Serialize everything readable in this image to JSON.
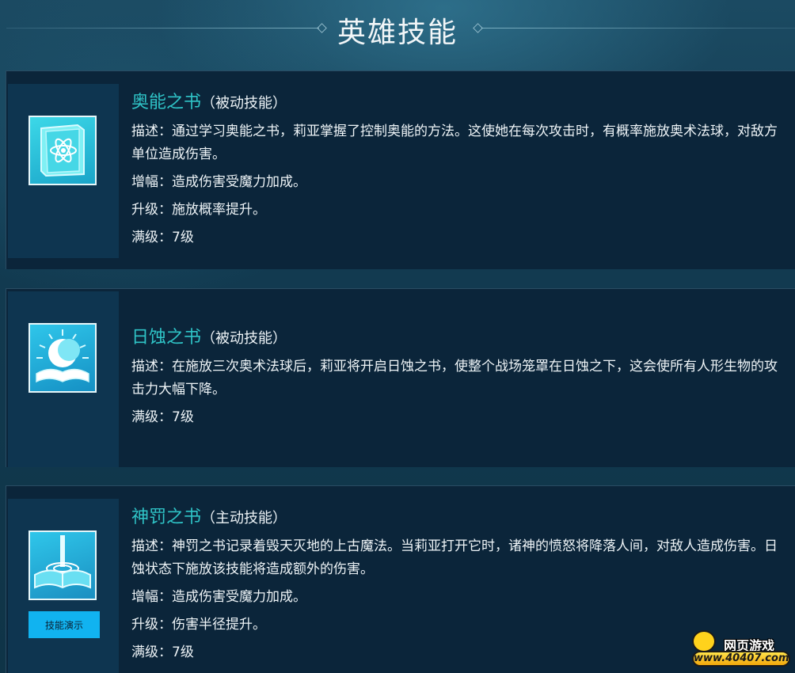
{
  "page": {
    "title": "英雄技能"
  },
  "skills": [
    {
      "name": "奥能之书",
      "type": "（被动技能）",
      "lines": [
        "描述：通过学习奥能之书，莉亚掌握了控制奥能的方法。这使她在每次攻击时，有概率施放奥术法球，对敌方单位造成伤害。",
        "增幅：造成伤害受魔力加成。",
        "升级：施放概率提升。",
        "满级：7级"
      ],
      "icon": "arcane-book-icon"
    },
    {
      "name": "日蚀之书",
      "type": "（被动技能）",
      "lines": [
        "描述：在施放三次奥术法球后，莉亚将开启日蚀之书，使整个战场笼罩在日蚀之下，这会使所有人形生物的攻击力大幅下降。",
        "满级：7级"
      ],
      "icon": "eclipse-book-icon"
    },
    {
      "name": "神罚之书",
      "type": "（主动技能）",
      "lines": [
        "描述：神罚之书记录着毁天灭地的上古魔法。当莉亚打开它时，诸神的愤怒将降落人间，对敌人造成伤害。日蚀状态下施放该技能将造成额外的伤害。",
        "增幅：造成伤害受魔力加成。",
        "升级：伤害半径提升。",
        "满级：7级"
      ],
      "icon": "divine-punishment-book-icon",
      "demo_label": "技能演示"
    }
  ],
  "watermark": {
    "top": "网页游戏",
    "bottom": "www.40407.com"
  },
  "colors": {
    "accent": "#2fc4c7",
    "card_bg": "#0b253a",
    "button": "#11b3f0"
  }
}
